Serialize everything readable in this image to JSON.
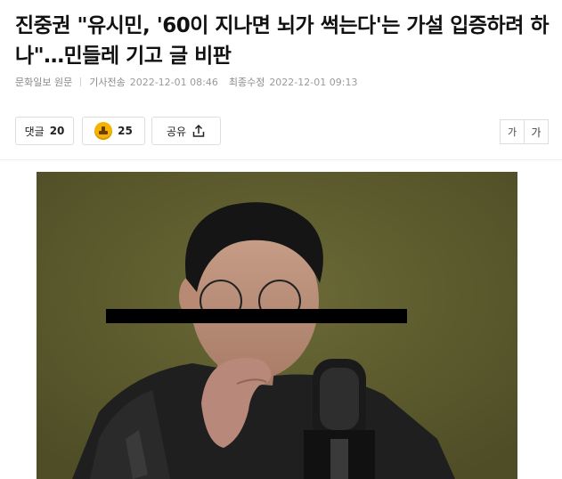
{
  "article": {
    "headline": "진중권 \"유시민, '60이 지나면 뇌가 썩는다'는 가설 입증하려 하나\"…민들레 기고 글 비판",
    "source": "문화일보 원문",
    "published_label": "기사전송",
    "published_time": "2022-12-01 08:46",
    "modified_label": "최종수정",
    "modified_time": "2022-12-01 09:13"
  },
  "toolbar": {
    "comments_label": "댓글",
    "comments_count": "20",
    "reaction_count": "25",
    "share_label": "공유",
    "font_small_label": "가",
    "font_large_label": "가"
  },
  "colors": {
    "photo_background": "#5a5a2c",
    "reaction_icon": "#f5b301",
    "censor_bar": "#000000"
  }
}
